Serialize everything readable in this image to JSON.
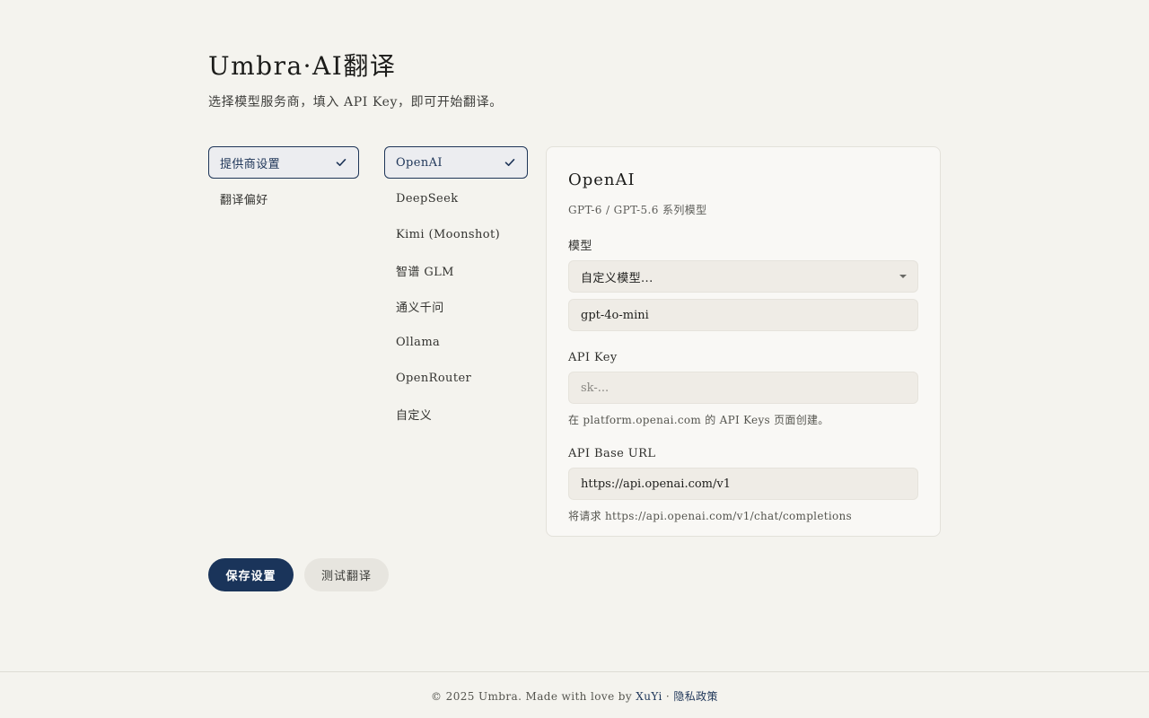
{
  "header": {
    "title": "Umbra·AI翻译",
    "subtitle": "选择模型服务商，填入 API Key，即可开始翻译。"
  },
  "settings_nav": {
    "items": [
      {
        "label": "提供商设置",
        "active": true
      },
      {
        "label": "翻译偏好",
        "active": false
      }
    ]
  },
  "providers": {
    "items": [
      {
        "label": "OpenAI",
        "active": true
      },
      {
        "label": "DeepSeek",
        "active": false
      },
      {
        "label": "Kimi (Moonshot)",
        "active": false
      },
      {
        "label": "智谱 GLM",
        "active": false
      },
      {
        "label": "通义千问",
        "active": false
      },
      {
        "label": "Ollama",
        "active": false
      },
      {
        "label": "OpenRouter",
        "active": false
      },
      {
        "label": "自定义",
        "active": false
      }
    ]
  },
  "panel": {
    "title": "OpenAI",
    "description": "GPT-6 / GPT-5.6 系列模型",
    "model_label": "模型",
    "model_select_value": "自定义模型...",
    "custom_model_value": "gpt-4o-mini",
    "api_key_label": "API Key",
    "api_key_placeholder": "sk-...",
    "api_key_hint": "在 platform.openai.com 的 API Keys 页面创建。",
    "base_url_label": "API Base URL",
    "base_url_value": "https://api.openai.com/v1",
    "base_url_hint": "将请求 https://api.openai.com/v1/chat/completions"
  },
  "actions": {
    "save_label": "保存设置",
    "test_label": "测试翻译"
  },
  "footer": {
    "copyright": "© 2025 Umbra. Made with love by ",
    "author_link": "XuYi",
    "separator": " · ",
    "privacy_link": "隐私政策"
  },
  "colors": {
    "accent": "#1a345a",
    "background": "#f4f3ee",
    "panel_background": "#f9f8f5"
  }
}
